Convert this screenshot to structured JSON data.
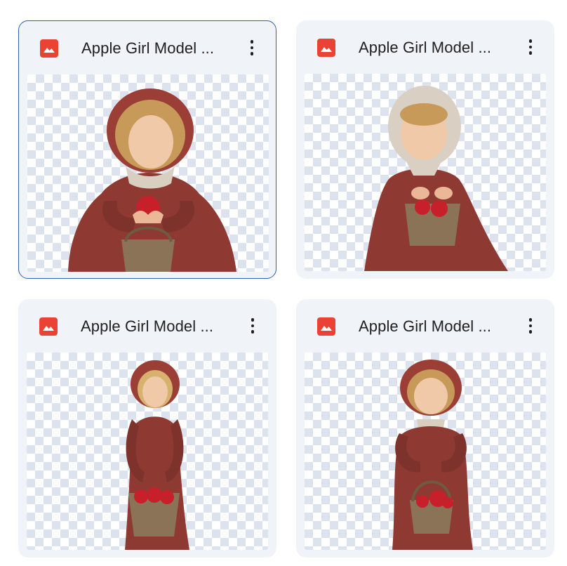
{
  "files": [
    {
      "title": "Apple Girl Model ...",
      "type": "image",
      "selected": true,
      "icon": "image-file-icon",
      "menu_icon": "more-vert-icon"
    },
    {
      "title": "Apple Girl Model ...",
      "type": "image",
      "selected": false,
      "icon": "image-file-icon",
      "menu_icon": "more-vert-icon"
    },
    {
      "title": "Apple Girl Model ...",
      "type": "image",
      "selected": false,
      "icon": "image-file-icon",
      "menu_icon": "more-vert-icon"
    },
    {
      "title": "Apple Girl Model ...",
      "type": "image",
      "selected": false,
      "icon": "image-file-icon",
      "menu_icon": "more-vert-icon"
    }
  ],
  "colors": {
    "card_background": "#f0f4f9",
    "selected_border": "#2f5fb3",
    "file_icon": "#ea4335",
    "dress": "#8e3a32",
    "apple": "#c8202a",
    "basket": "#8a7356"
  }
}
